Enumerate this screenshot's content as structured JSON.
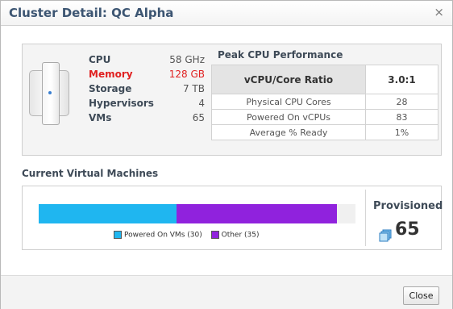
{
  "dialog": {
    "title": "Cluster Detail: QC Alpha",
    "close_symbol": "×",
    "close_button_label": "Close"
  },
  "specs": [
    {
      "label": "CPU",
      "value": "58 GHz",
      "highlight": false
    },
    {
      "label": "Memory",
      "value": "128 GB",
      "highlight": true
    },
    {
      "label": "Storage",
      "value": "7 TB",
      "highlight": false
    },
    {
      "label": "Hypervisors",
      "value": "4",
      "highlight": false
    },
    {
      "label": "VMs",
      "value": "65",
      "highlight": false
    }
  ],
  "peak_cpu": {
    "title": "Peak CPU Performance",
    "ratio_label": "vCPU/Core Ratio",
    "ratio_value": "3.0:1",
    "rows": [
      {
        "label": "Physical CPU Cores",
        "value": "28"
      },
      {
        "label": "Powered On vCPUs",
        "value": "83"
      },
      {
        "label": "Average % Ready",
        "value": "1%"
      }
    ]
  },
  "vms": {
    "section_title": "Current Virtual Machines",
    "segments": [
      {
        "label": "Powered On VMs (30)",
        "count": 30,
        "color": "#1fb6f0"
      },
      {
        "label": "Other (35)",
        "count": 35,
        "color": "#9022dd"
      }
    ],
    "bar_capacity": 69,
    "provisioned_label": "Provisioned",
    "provisioned_count": "65",
    "provisioned_icon": "vm-stack-icon"
  },
  "colors": {
    "title_text": "#3c5572",
    "alert_red": "#e02020",
    "accent_blue": "#1fb6f0",
    "accent_purple": "#9022dd"
  }
}
